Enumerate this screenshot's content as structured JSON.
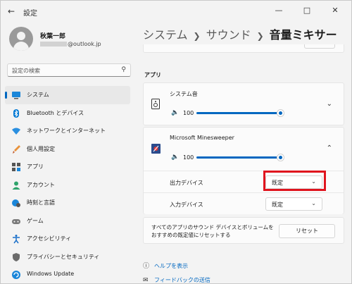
{
  "window": {
    "title": "設定",
    "back_icon": "back-arrow-icon",
    "controls": [
      "minimize-icon",
      "maximize-icon",
      "close-icon"
    ]
  },
  "user": {
    "name": "秋葉一郎",
    "email_suffix": "@outlook.jp"
  },
  "search": {
    "placeholder": "設定の検索",
    "icon": "search-icon"
  },
  "sidebar": {
    "items": [
      {
        "label": "システム",
        "icon": "monitor-icon",
        "active": true
      },
      {
        "label": "Bluetooth とデバイス",
        "icon": "bluetooth-icon"
      },
      {
        "label": "ネットワークとインターネット",
        "icon": "wifi-icon"
      },
      {
        "label": "個人用設定",
        "icon": "brush-icon"
      },
      {
        "label": "アプリ",
        "icon": "apps-icon"
      },
      {
        "label": "アカウント",
        "icon": "account-icon"
      },
      {
        "label": "時刻と言語",
        "icon": "clock-globe-icon"
      },
      {
        "label": "ゲーム",
        "icon": "gamepad-icon"
      },
      {
        "label": "アクセシビリティ",
        "icon": "accessibility-icon"
      },
      {
        "label": "プライバシーとセキュリティ",
        "icon": "shield-icon"
      },
      {
        "label": "Windows Update",
        "icon": "update-icon"
      }
    ]
  },
  "breadcrumb": {
    "part1": "システム",
    "part2": "サウンド",
    "current": "音量ミキサー"
  },
  "apps": {
    "section_label": "アプリ",
    "system_sound": {
      "title": "システム音",
      "volume": "100",
      "level": 1.0
    },
    "minesweeper": {
      "title": "Microsoft Minesweeper",
      "volume": "100",
      "level": 1.0,
      "output_label": "出力デバイス",
      "output_value": "既定",
      "input_label": "入力デバイス",
      "input_value": "既定"
    }
  },
  "reset": {
    "text": "すべてのアプリのサウンド デバイスとボリュームをおすすめの既定値にリセットする",
    "button": "リセット"
  },
  "links": {
    "help": "ヘルプを表示",
    "feedback": "フィードバックの送信"
  },
  "colors": {
    "accent": "#0067c0",
    "highlight": "#e0141e"
  }
}
